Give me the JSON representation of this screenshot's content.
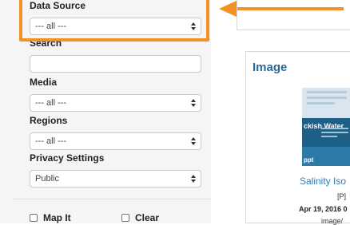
{
  "filters": {
    "data_source": {
      "label": "Data Source",
      "value": "--- all ---"
    },
    "search": {
      "label": "Search",
      "value": ""
    },
    "media": {
      "label": "Media",
      "value": "--- all ---"
    },
    "regions": {
      "label": "Regions",
      "value": "--- all ---"
    },
    "privacy": {
      "label": "Privacy Settings",
      "value": "Public"
    },
    "map_it_label": "Map It",
    "clear_label": "Clear"
  },
  "results": {
    "card_title": "Image",
    "thumbnail": {
      "band_text": "ckish Water",
      "footer_text": "ppt"
    },
    "item_title": "Salinity Iso",
    "item_meta": "[P]",
    "item_date": "Apr 19, 2016 0",
    "item_path": "image/"
  },
  "colors": {
    "highlight": "#f39122",
    "link": "#2d7fb6"
  }
}
